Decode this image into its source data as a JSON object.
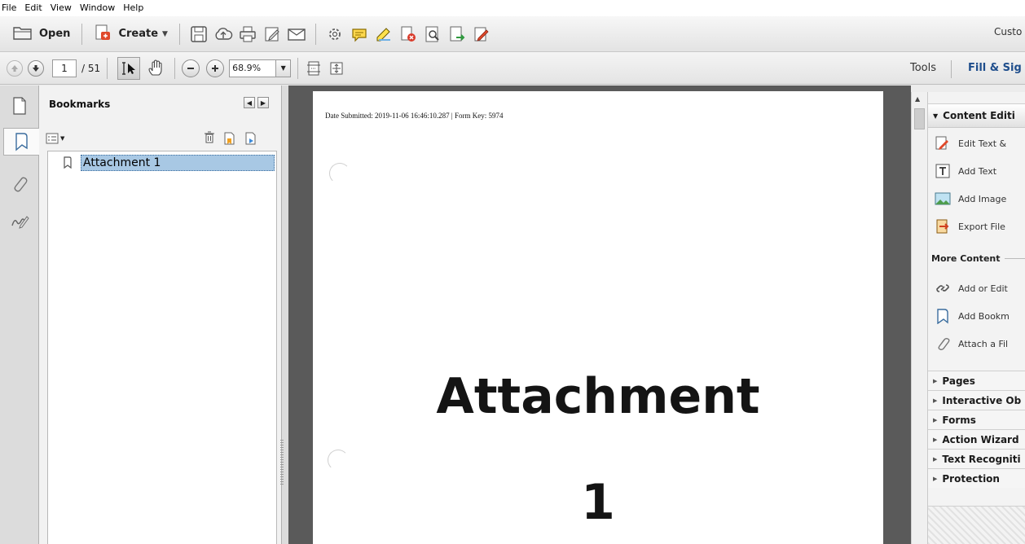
{
  "menu": [
    "File",
    "Edit",
    "View",
    "Window",
    "Help"
  ],
  "toolbar": {
    "open_label": "Open",
    "create_label": "Create",
    "right_cut_label": "Custo",
    "icons": [
      "save-icon",
      "upload-cloud-icon",
      "print-icon",
      "edit-pencil-icon",
      "email-icon",
      "gear-icon",
      "comment-icon",
      "highlight-icon",
      "pdf-remove-icon",
      "pdf-search-icon",
      "pdf-export-icon",
      "edit-text-icon"
    ]
  },
  "nav": {
    "current_page": "1",
    "total_pages": "/ 51",
    "zoom": "68.9%",
    "tools_label": "Tools",
    "fill_sign_label": "Fill & Sig"
  },
  "bookmarks": {
    "title": "Bookmarks",
    "items": [
      {
        "label": "Attachment 1"
      }
    ]
  },
  "document": {
    "stamp": "Date Submitted: 2019-11-06 16:46:10.287 | Form Key: 5974",
    "heading_line1": "Attachment",
    "heading_line2": "1"
  },
  "right_panel": {
    "section_open": "Content Editi",
    "items": [
      "Edit Text &",
      "Add Text",
      "Add Image",
      "Export File"
    ],
    "more_content": "More Content",
    "more_items": [
      "Add or Edit",
      "Add Bookm",
      "Attach a Fil"
    ],
    "sections": [
      "Pages",
      "Interactive Ob",
      "Forms",
      "Action Wizard",
      "Text Recogniti",
      "Protection"
    ]
  },
  "colors": {
    "selection": "#a8c8e4",
    "doc_background": "#5a5a5a",
    "fill_sign": "#1f4e8c"
  }
}
